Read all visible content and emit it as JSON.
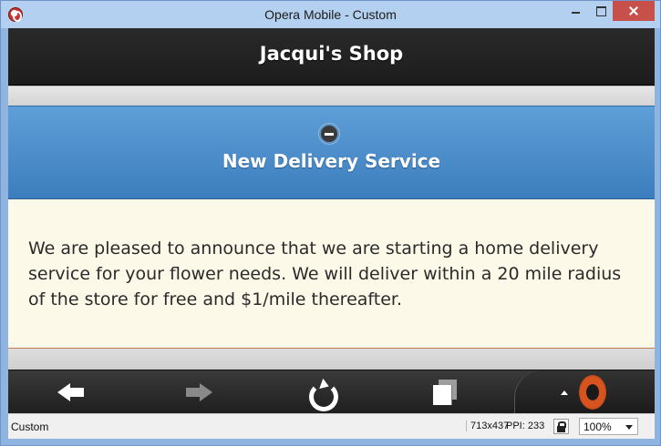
{
  "window": {
    "title": "Opera Mobile - Custom"
  },
  "page": {
    "header_title": "Jacqui's Shop",
    "collapsible": {
      "title": "New Delivery Service",
      "state_icon": "minus-circle-icon",
      "body_text": "We are pleased to announce that we are starting a home delivery service for your flower needs. We will deliver within a 20 mile radius of the store for free and $1/mile thereafter."
    }
  },
  "toolbar": {
    "back_icon": "back-arrow-icon",
    "forward_icon": "forward-arrow-icon",
    "reload_icon": "reload-icon",
    "tabs_icon": "tabs-icon",
    "menu_icon": "opera-logo-icon"
  },
  "statusbar": {
    "profile": "Custom",
    "resolution": "713x437",
    "ppi": "PPI: 233",
    "zoom": "100%"
  },
  "colors": {
    "header_bg": "#1c1c1c",
    "collapsible_bg": "#4a8ccb",
    "content_bg": "#fdf9e9",
    "close_button": "#c7504a"
  }
}
